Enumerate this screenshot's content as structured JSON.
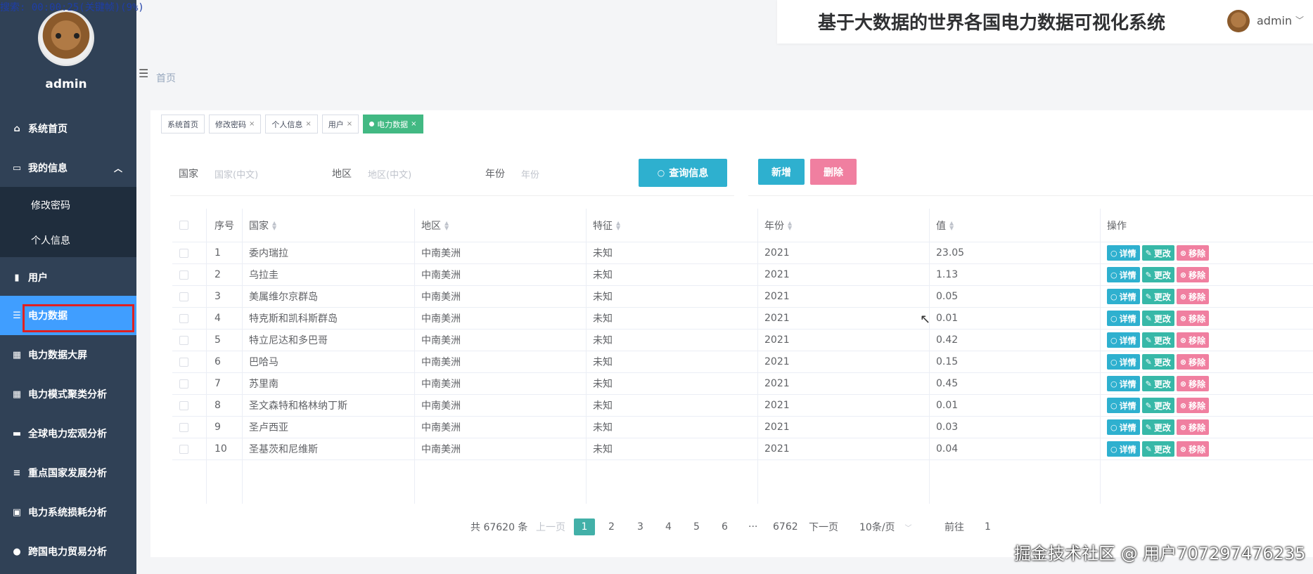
{
  "overlay": {
    "timer_text": "搜索: 00:00:25(关键帧)(9%)"
  },
  "sidebar": {
    "username": "admin",
    "menu": [
      {
        "label": "系统首页",
        "icon": "home-icon"
      },
      {
        "label": "我的信息",
        "icon": "card-icon",
        "expanded": true
      },
      {
        "label": "用户",
        "icon": "briefcase-icon"
      },
      {
        "label": "电力数据",
        "icon": "list-icon",
        "active": true
      },
      {
        "label": "电力数据大屏",
        "icon": "grid-icon"
      },
      {
        "label": "电力模式聚类分析",
        "icon": "grid-icon"
      },
      {
        "label": "全球电力宏观分析",
        "icon": "printer-icon"
      },
      {
        "label": "重点国家发展分析",
        "icon": "sliders-icon"
      },
      {
        "label": "电力系统损耗分析",
        "icon": "clipboard-icon"
      },
      {
        "label": "跨国电力贸易分析",
        "icon": "bulb-icon"
      }
    ],
    "submenu": [
      "修改密码",
      "个人信息"
    ]
  },
  "header": {
    "title": "基于大数据的世界各国电力数据可视化系统",
    "username": "admin"
  },
  "breadcrumb": "首页",
  "tags": [
    {
      "label": "系统首页",
      "closable": false
    },
    {
      "label": "修改密码",
      "closable": true
    },
    {
      "label": "个人信息",
      "closable": true
    },
    {
      "label": "用户",
      "closable": true
    },
    {
      "label": "电力数据",
      "closable": true,
      "active": true
    }
  ],
  "search": {
    "country_label": "国家",
    "country_placeholder": "国家(中文)",
    "region_label": "地区",
    "region_placeholder": "地区(中文)",
    "year_label": "年份",
    "year_placeholder": "年份",
    "query_button": "查询信息"
  },
  "actions": {
    "add": "新增",
    "delete": "删除"
  },
  "table": {
    "headers": [
      "序号",
      "国家",
      "地区",
      "特征",
      "年份",
      "值",
      "操作"
    ],
    "row_actions": {
      "detail": "详情",
      "edit": "更改",
      "remove": "移除"
    },
    "rows": [
      [
        "1",
        "委内瑞拉",
        "中南美洲",
        "未知",
        "2021",
        "23.05"
      ],
      [
        "2",
        "乌拉圭",
        "中南美洲",
        "未知",
        "2021",
        "1.13"
      ],
      [
        "3",
        "美属维尔京群岛",
        "中南美洲",
        "未知",
        "2021",
        "0.05"
      ],
      [
        "4",
        "特克斯和凯科斯群岛",
        "中南美洲",
        "未知",
        "2021",
        "0.01"
      ],
      [
        "5",
        "特立尼达和多巴哥",
        "中南美洲",
        "未知",
        "2021",
        "0.42"
      ],
      [
        "6",
        "巴哈马",
        "中南美洲",
        "未知",
        "2021",
        "0.15"
      ],
      [
        "7",
        "苏里南",
        "中南美洲",
        "未知",
        "2021",
        "0.45"
      ],
      [
        "8",
        "圣文森特和格林纳丁斯",
        "中南美洲",
        "未知",
        "2021",
        "0.01"
      ],
      [
        "9",
        "圣卢西亚",
        "中南美洲",
        "未知",
        "2021",
        "0.03"
      ],
      [
        "10",
        "圣基茨和尼维斯",
        "中南美洲",
        "未知",
        "2021",
        "0.04"
      ]
    ]
  },
  "pagination": {
    "total": "共 67620 条",
    "prev": "上一页",
    "next": "下一页",
    "pages": [
      "1",
      "2",
      "3",
      "4",
      "5",
      "6"
    ],
    "ellipsis": "···",
    "last": "6762",
    "page_size": "10条/页",
    "goto_label": "前往",
    "goto_value": "1"
  },
  "watermark": "掘金技术社区 @ 用户707297476235"
}
